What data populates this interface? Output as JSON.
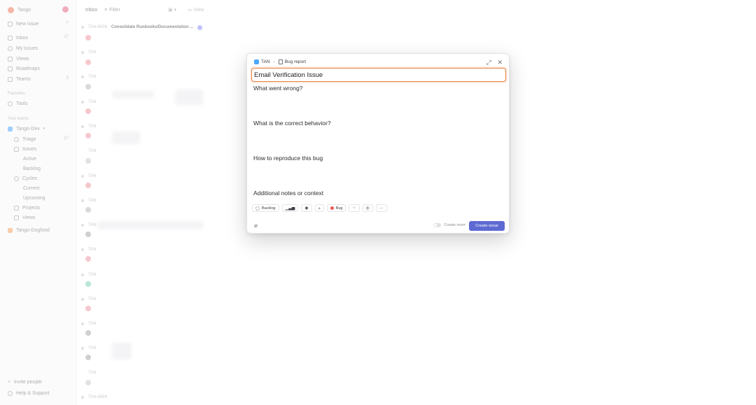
{
  "sidebar": {
    "workspace": "Tango",
    "new_issue": "New issue",
    "nav": [
      {
        "label": "Inbox",
        "count": "17"
      },
      {
        "label": "My issues"
      },
      {
        "label": "Views"
      },
      {
        "label": "Roadmaps"
      },
      {
        "label": "Teams",
        "count": "5"
      }
    ],
    "favorites_label": "Favorites",
    "favorites": [
      {
        "label": "Tools"
      }
    ],
    "teams_label": "Your teams",
    "team": "Tango-Dev",
    "team_items": [
      {
        "label": "Triage",
        "count": "17"
      },
      {
        "label": "Issues"
      },
      {
        "label": "Active"
      },
      {
        "label": "Backlog"
      },
      {
        "label": "Cycles"
      },
      {
        "label": "Current"
      },
      {
        "label": "Upcoming"
      },
      {
        "label": "Projects"
      },
      {
        "label": "Views"
      }
    ],
    "other_team": "Tango-Dogfood",
    "invite": "Invite people",
    "help": "Help & Support"
  },
  "topbar": {
    "title": "Inbox",
    "filter": "Filter",
    "view": "View"
  },
  "list": {
    "first_id": "TAN-6008",
    "first_title": "Consolidate Runbooks/Documentation ...",
    "rows": [
      "TAN",
      "TAN",
      "TAN",
      "TAN",
      "TAN",
      "TAN",
      "TAN",
      "TAN",
      "TAN",
      "TAN",
      "TAN",
      "TAN",
      "TAN",
      "TAN"
    ],
    "last_id": "TAN-5984"
  },
  "modal": {
    "team": "TAN",
    "template": "Bug report",
    "title_value": "Email Verification Issue",
    "prompts": [
      "What went wrong?",
      "What is the correct behavior?",
      "How to reproduce this bug",
      "Additional notes or context"
    ],
    "status": "Backlog",
    "label": "Bug",
    "create_more": "Create more",
    "create_button": "Create issue",
    "colors": {
      "accent": "#5e6ad2",
      "focus_border": "#e8803c",
      "bug": "#eb5757"
    }
  }
}
